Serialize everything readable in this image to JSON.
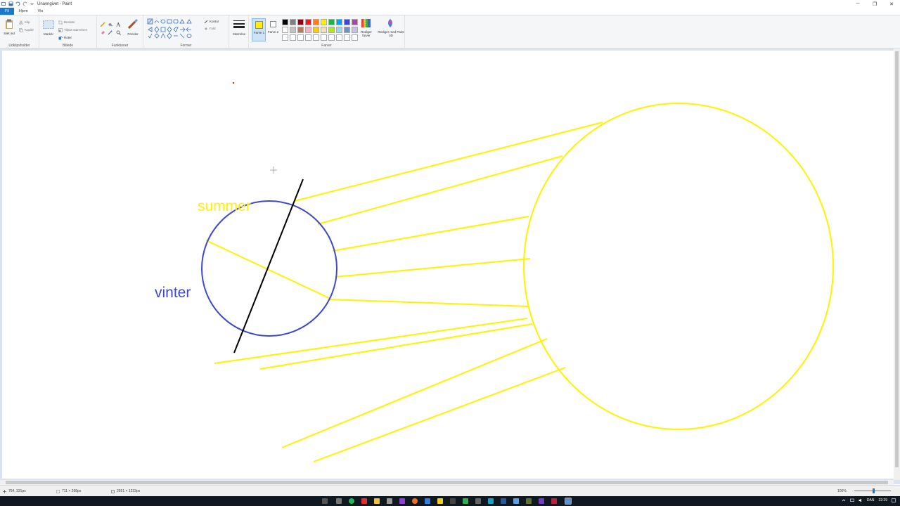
{
  "window": {
    "title": "Unavngivet - Paint",
    "minimize": "─",
    "maximize": "❐",
    "close": "✕"
  },
  "tabs": [
    {
      "label": "Fil"
    },
    {
      "label": "Hjem"
    },
    {
      "label": "Vis"
    }
  ],
  "ribbon": {
    "clipboard": {
      "paste_label": "Sæt ind",
      "cut_label": "Klip",
      "copy_label": "Kopiér",
      "group_label": "Udklipsholder"
    },
    "image": {
      "select_label": "Markér",
      "crop_label": "Beskær",
      "resize_label": "Tilpas størrelsen",
      "rotate_label": "Roter",
      "group_label": "Billede"
    },
    "tools": {
      "group_label": "Funktioner",
      "brushes_label": "Pensler"
    },
    "shapes": {
      "outline_label": "Kontur",
      "fill_label": "Fyld",
      "group_label": "Former"
    },
    "size": {
      "label": "Størrelse"
    },
    "colors": {
      "color1_label": "Farve 1",
      "color2_label": "Farve 2",
      "edit_colors_label": "Rediger farver",
      "paint3d_label": "Rediger med Paint 3D",
      "group_label": "Farver",
      "color1": "#fff200",
      "color2": "#ffffff",
      "palette": [
        "#000000",
        "#7f7f7f",
        "#880015",
        "#ed1c24",
        "#ff7f27",
        "#fff200",
        "#22b14c",
        "#00a2e8",
        "#3f48cc",
        "#a349a4",
        "#ffffff",
        "#c3c3c3",
        "#b97a57",
        "#ffaec9",
        "#ffc90e",
        "#efe4b0",
        "#b5e61d",
        "#99d9ea",
        "#7092be",
        "#c8bfe7",
        "#ffffff",
        "#ffffff",
        "#ffffff",
        "#ffffff",
        "#ffffff",
        "#ffffff",
        "#ffffff",
        "#ffffff",
        "#ffffff",
        "#ffffff"
      ]
    }
  },
  "canvas": {
    "summer_label": "summer",
    "vinter_label": "vinter",
    "earth_color": "#3f48cc",
    "sun_color": "#fff200",
    "axis_color": "#000000"
  },
  "status": {
    "cursor_pos": "764, 331px",
    "selection_size": "711 × 268px",
    "image_size": "2551 × 1233px",
    "zoom": "100%"
  },
  "taskbar": {
    "language": "DAN",
    "time": "22:29"
  }
}
